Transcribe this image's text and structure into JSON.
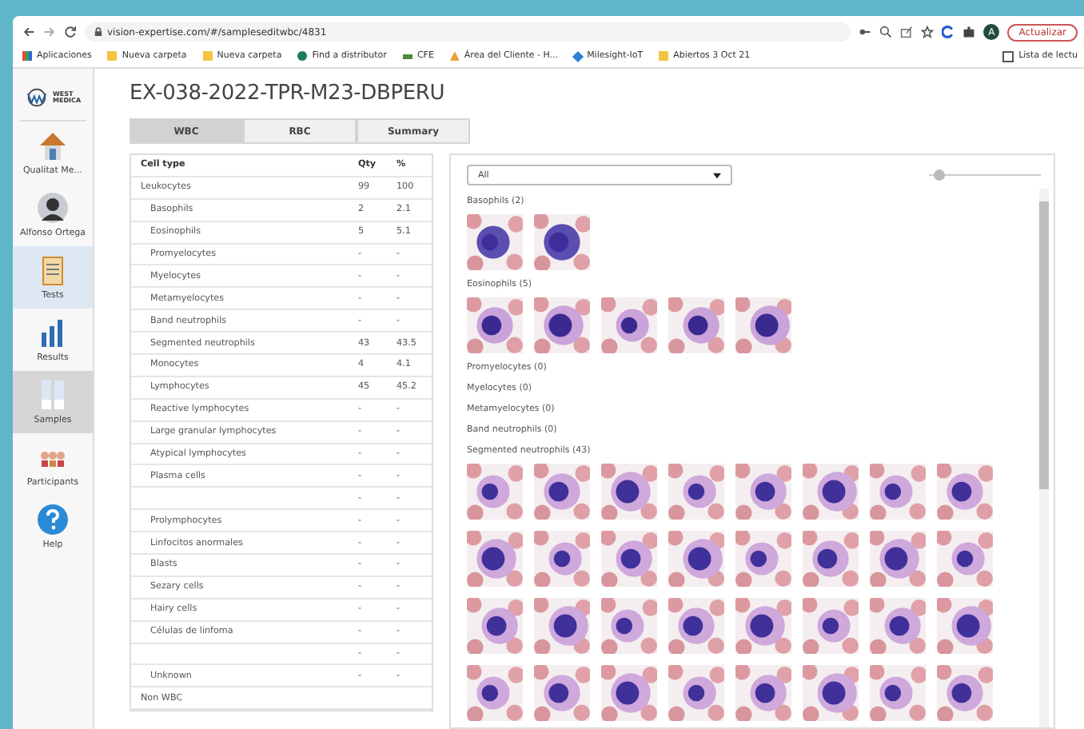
{
  "browser": {
    "url": "vision-expertise.com/#/sampleseditwbc/4831",
    "update_button": "Actualizar",
    "profile_initial": "A",
    "bookmarks": [
      {
        "label": "Aplicaciones",
        "kind": "apps"
      },
      {
        "label": "Nueva carpeta",
        "kind": "folder"
      },
      {
        "label": "Nueva carpeta",
        "kind": "folder"
      },
      {
        "label": "Find a distributor",
        "kind": "globe"
      },
      {
        "label": "CFE",
        "kind": "cfe"
      },
      {
        "label": "Área del Cliente - H...",
        "kind": "warning"
      },
      {
        "label": "Milesight-IoT",
        "kind": "diamond"
      },
      {
        "label": "Abiertos 3 Oct 21",
        "kind": "folder"
      }
    ],
    "reading_list": "Lista de lectu"
  },
  "logo": {
    "text": "WEST MEDICA"
  },
  "sidebar": {
    "items": [
      {
        "label": "Qualitat Me...",
        "kind": "home",
        "selected": false,
        "highlighted": false
      },
      {
        "label": "Alfonso Ortega",
        "kind": "user",
        "selected": false,
        "highlighted": false
      },
      {
        "label": "Tests",
        "kind": "tests",
        "selected": false,
        "highlighted": true
      },
      {
        "label": "Results",
        "kind": "results",
        "selected": false,
        "highlighted": false
      },
      {
        "label": "Samples",
        "kind": "samples",
        "selected": true,
        "highlighted": false
      },
      {
        "label": "Participants",
        "kind": "participants",
        "selected": false,
        "highlighted": false
      },
      {
        "label": "Help",
        "kind": "help",
        "selected": false,
        "highlighted": false
      }
    ]
  },
  "title": "EX-038-2022-TPR-M23-DBPERU",
  "tabs": [
    {
      "label": "WBC",
      "selected": true
    },
    {
      "label": "RBC",
      "selected": false
    },
    {
      "label": "Summary",
      "selected": false
    }
  ],
  "table": {
    "columns": [
      "Cell type",
      "Qty",
      "%"
    ],
    "rows": [
      {
        "name": "Leukocytes",
        "qty": "99",
        "pct": "100",
        "children": [
          {
            "name": "Basophils",
            "qty": "2",
            "pct": "2.1"
          },
          {
            "name": "Eosinophils",
            "qty": "5",
            "pct": "5.1"
          },
          {
            "name": "Promyelocytes",
            "qty": "-",
            "pct": "-"
          },
          {
            "name": "Myelocytes",
            "qty": "-",
            "pct": "-"
          },
          {
            "name": "Metamyelocytes",
            "qty": "-",
            "pct": "-"
          },
          {
            "name": "Band neutrophils",
            "qty": "-",
            "pct": "-"
          },
          {
            "name": "Segmented neutrophils",
            "qty": "43",
            "pct": "43.5"
          },
          {
            "name": "Monocytes",
            "qty": "4",
            "pct": "4.1"
          },
          {
            "name": "Lymphocytes",
            "qty": "45",
            "pct": "45.2"
          },
          {
            "name": "Reactive lymphocytes",
            "qty": "-",
            "pct": "-"
          },
          {
            "name": "Large granular lymphocytes",
            "qty": "-",
            "pct": "-"
          },
          {
            "name": "Atypical lymphocytes",
            "qty": "-",
            "pct": "-"
          },
          {
            "name": "Plasma cells",
            "qty": "-",
            "pct": "-"
          },
          {
            "qty": "-",
            "pct": "-"
          },
          {
            "name": "Prolymphocytes",
            "qty": "-",
            "pct": "-"
          },
          {
            "name": "Linfocitos anormales",
            "qty": "-",
            "pct": "-"
          },
          {
            "name": "Blasts",
            "qty": "-",
            "pct": "-"
          },
          {
            "name": "Sezary cells",
            "qty": "-",
            "pct": "-"
          },
          {
            "name": "Hairy cells",
            "qty": "-",
            "pct": "-"
          },
          {
            "name": "Células de linfoma",
            "qty": "-",
            "pct": "-"
          },
          {
            "qty": "-",
            "pct": "-"
          },
          {
            "name": "Unknown",
            "qty": "-",
            "pct": "-"
          }
        ]
      },
      {
        "name": "Non WBC"
      }
    ]
  },
  "gallery": {
    "filter": "All",
    "zoom": {
      "level": 0.08
    },
    "groups": [
      {
        "label": "Basophils (2)",
        "images": [
          {
            "kind": "basophil"
          },
          {
            "kind": "basophil"
          }
        ]
      },
      {
        "label": "Eosinophils (5)",
        "images": [
          {
            "kind": "eosinophil"
          },
          {
            "kind": "eosinophil"
          },
          {
            "kind": "eosinophil"
          },
          {
            "kind": "eosinophil"
          },
          {
            "kind": "eosinophil"
          }
        ]
      },
      {
        "label": "Promyelocytes (0)"
      },
      {
        "label": "Myelocytes (0)"
      },
      {
        "label": "Metamyelocytes (0)"
      },
      {
        "label": "Band neutrophils (0)"
      },
      {
        "label": "Segmented neutrophils (43)",
        "images": [
          {
            "kind": "neutrophil"
          },
          {
            "kind": "neutrophil"
          },
          {
            "kind": "neutrophil"
          },
          {
            "kind": "neutrophil"
          },
          {
            "kind": "neutrophil"
          },
          {
            "kind": "neutrophil"
          },
          {
            "kind": "neutrophil"
          },
          {
            "kind": "neutrophil"
          },
          {
            "kind": "neutrophil"
          },
          {
            "kind": "neutrophil"
          },
          {
            "kind": "neutrophil"
          },
          {
            "kind": "neutrophil"
          },
          {
            "kind": "neutrophil"
          },
          {
            "kind": "neutrophil"
          },
          {
            "kind": "neutrophil"
          },
          {
            "kind": "neutrophil"
          },
          {
            "kind": "neutrophil"
          },
          {
            "kind": "neutrophil"
          },
          {
            "kind": "neutrophil"
          },
          {
            "kind": "neutrophil"
          },
          {
            "kind": "neutrophil"
          },
          {
            "kind": "neutrophil"
          },
          {
            "kind": "neutrophil"
          },
          {
            "kind": "neutrophil"
          },
          {
            "kind": "neutrophil"
          },
          {
            "kind": "neutrophil"
          },
          {
            "kind": "neutrophil"
          },
          {
            "kind": "neutrophil"
          },
          {
            "kind": "neutrophil"
          },
          {
            "kind": "neutrophil"
          },
          {
            "kind": "neutrophil"
          },
          {
            "kind": "neutrophil"
          }
        ]
      }
    ]
  }
}
